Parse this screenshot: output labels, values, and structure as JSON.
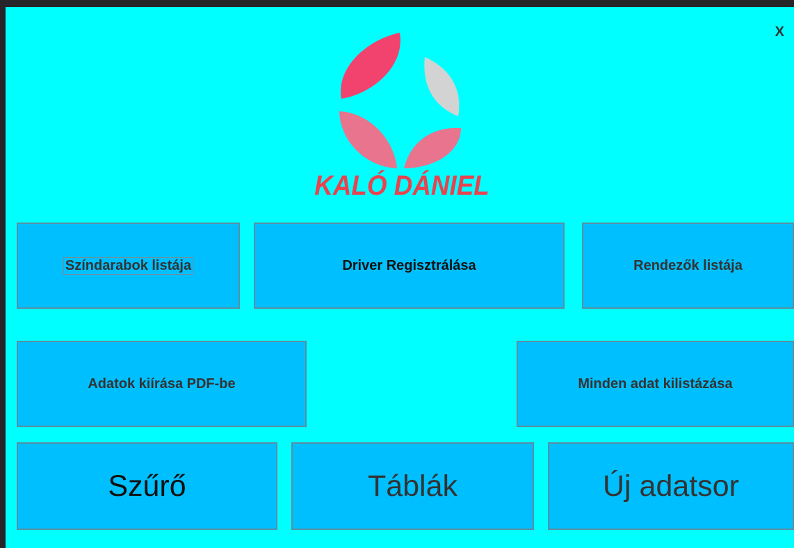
{
  "window": {
    "close_label": "X"
  },
  "logo": {
    "text": "KALÓ DÁNIEL",
    "colors": {
      "primary": "#f2436e",
      "secondary": "#e8748e",
      "light": "#d3d3d3",
      "text": "#e8434f"
    }
  },
  "buttons": {
    "plays_list": "Színdarabok listája",
    "driver_register": "Driver Regisztrálása",
    "directors_list": "Rendezők listája",
    "export_pdf": "Adatok kiírása PDF-be",
    "list_all": "Minden adat kilistázása",
    "filter": "Szűrő",
    "tables": "Táblák",
    "new_record": "Új adatsor"
  },
  "colors": {
    "background": "#00ffff",
    "button": "#00bfff",
    "button_border": "#5a8fa3"
  }
}
